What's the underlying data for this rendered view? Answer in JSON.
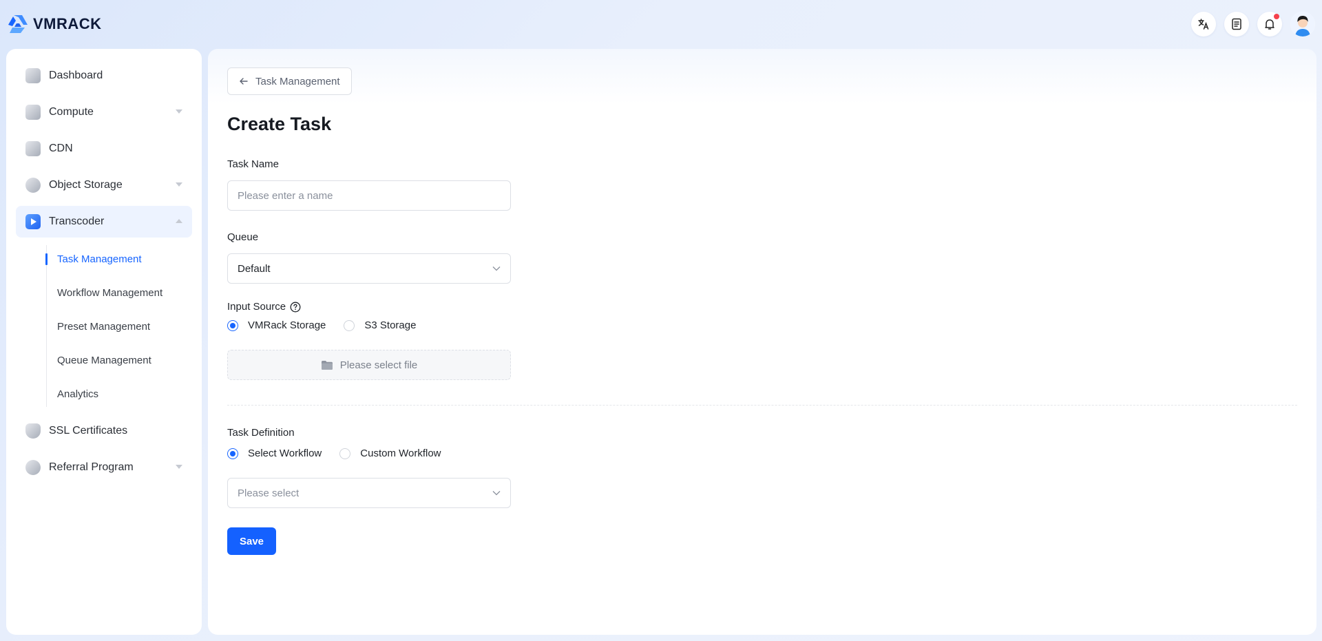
{
  "brand": {
    "name": "VMRACK",
    "accent": "#1765ff"
  },
  "header": {
    "icons": [
      "translate-icon",
      "document-icon",
      "bell-icon"
    ],
    "notification_dot_color": "#f5414c"
  },
  "sidebar": {
    "items": [
      {
        "label": "Dashboard",
        "icon": "dashboard-icon"
      },
      {
        "label": "Compute",
        "icon": "compute-icon"
      },
      {
        "label": "CDN",
        "icon": "cdn-icon"
      },
      {
        "label": "Object Storage",
        "icon": "object-storage-icon"
      },
      {
        "label": "Transcoder",
        "icon": "transcoder-icon"
      },
      {
        "label": "SSL Certificates",
        "icon": "ssl-icon"
      },
      {
        "label": "Referral Program",
        "icon": "referral-icon"
      }
    ],
    "transcoder_sub": [
      {
        "label": "Task Management"
      },
      {
        "label": "Workflow Management"
      },
      {
        "label": "Preset Management"
      },
      {
        "label": "Queue Management"
      },
      {
        "label": "Analytics"
      }
    ]
  },
  "main": {
    "back_label": "Task Management",
    "title": "Create Task",
    "task_name": {
      "label": "Task Name",
      "placeholder": "Please enter a name",
      "value": ""
    },
    "queue": {
      "label": "Queue",
      "value": "Default"
    },
    "input_source": {
      "label": "Input Source",
      "options": [
        "VMRack Storage",
        "S3 Storage"
      ],
      "selected": "VMRack Storage",
      "file_placeholder": "Please select file"
    },
    "task_definition": {
      "label": "Task Definition",
      "options": [
        "Select Workflow",
        "Custom Workflow"
      ],
      "selected": "Select Workflow",
      "select_placeholder": "Please select"
    },
    "save_label": "Save"
  }
}
